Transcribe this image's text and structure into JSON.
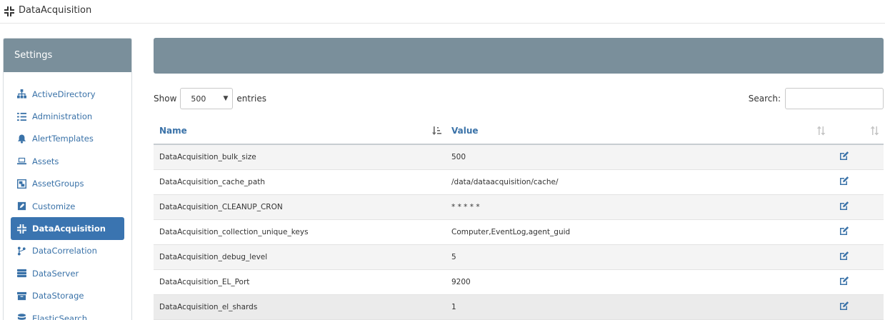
{
  "topbar": {
    "title": "DataAcquisition",
    "icon": "compress-icon"
  },
  "sidebar": {
    "title": "Settings",
    "items": [
      {
        "label": "ActiveDirectory",
        "icon": "sitemap-icon",
        "active": false
      },
      {
        "label": "Administration",
        "icon": "list-check-icon",
        "active": false
      },
      {
        "label": "AlertTemplates",
        "icon": "bell-icon",
        "active": false
      },
      {
        "label": "Assets",
        "icon": "laptop-icon",
        "active": false
      },
      {
        "label": "AssetGroups",
        "icon": "object-group-icon",
        "active": false
      },
      {
        "label": "Customize",
        "icon": "pen-square-icon",
        "active": false
      },
      {
        "label": "DataAcquisition",
        "icon": "compress-icon",
        "active": true
      },
      {
        "label": "DataCorrelation",
        "icon": "code-branch-icon",
        "active": false
      },
      {
        "label": "DataServer",
        "icon": "server-icon",
        "active": false
      },
      {
        "label": "DataStorage",
        "icon": "archive-icon",
        "active": false
      },
      {
        "label": "ElasticSearch",
        "icon": "database-icon",
        "active": false
      }
    ]
  },
  "controls": {
    "show_label": "Show",
    "entries_value": "500",
    "entries_label": "entries",
    "search_label": "Search:",
    "search_value": ""
  },
  "table": {
    "columns": [
      "Name",
      "Value"
    ],
    "rows": [
      {
        "name": "DataAcquisition_bulk_size",
        "value": "500"
      },
      {
        "name": "DataAcquisition_cache_path",
        "value": "/data/dataacquisition/cache/"
      },
      {
        "name": "DataAcquisition_CLEANUP_CRON",
        "value": "* * * * *"
      },
      {
        "name": "DataAcquisition_collection_unique_keys",
        "value": "Computer,EventLog,agent_guid"
      },
      {
        "name": "DataAcquisition_debug_level",
        "value": "5"
      },
      {
        "name": "DataAcquisition_EL_Port",
        "value": "9200"
      },
      {
        "name": "DataAcquisition_el_shards",
        "value": "1"
      }
    ]
  },
  "colors": {
    "accent": "#3a72a8",
    "header_bg": "#7a8f9b",
    "active_bg": "#3a74b0"
  }
}
